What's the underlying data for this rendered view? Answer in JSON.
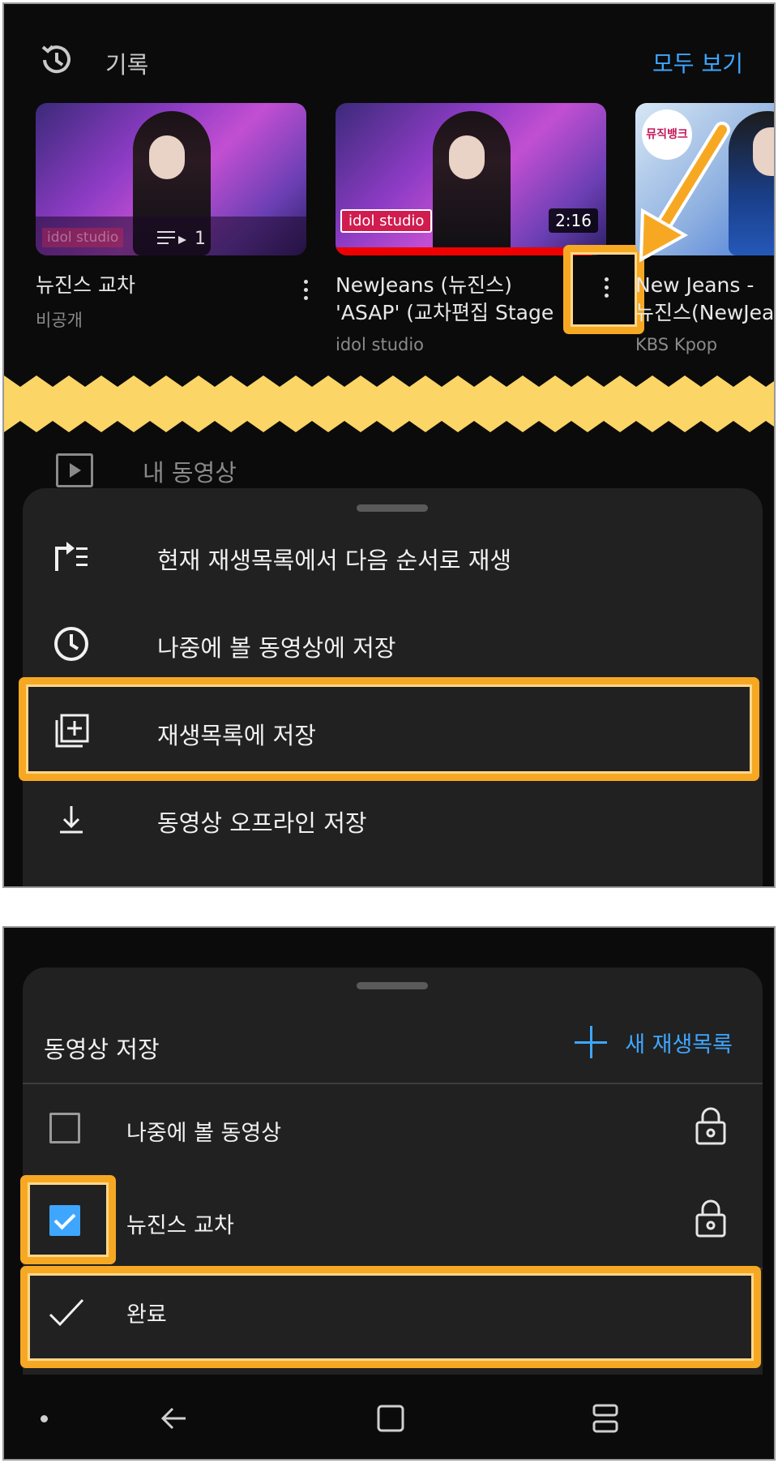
{
  "screen1": {
    "history": {
      "title": "기록",
      "see_all": "모두 보기"
    },
    "cards": [
      {
        "title": "뉴진스 교차",
        "subtitle": "비공개",
        "overlay_badge": "idol studio",
        "playlist_count": "1"
      },
      {
        "title_line1": "NewJeans (뉴진스)",
        "title_line2": "'ASAP' (교차편집 Stage",
        "channel": "idol studio",
        "badge": "idol studio",
        "duration": "2:16",
        "watched_fraction": 0.95
      },
      {
        "title_line1": "New Jeans -",
        "title_line2": "뉴진스(NewJea",
        "channel": "KBS Kpop",
        "logo_text": "뮤직뱅크"
      }
    ],
    "my_videos": "내 동영상",
    "menu": [
      {
        "icon": "play-next-icon",
        "label": "현재 재생목록에서 다음 순서로 재생"
      },
      {
        "icon": "clock-icon",
        "label": "나중에 볼 동영상에 저장"
      },
      {
        "icon": "playlist-add-icon",
        "label": "재생목록에 저장"
      },
      {
        "icon": "download-icon",
        "label": "동영상 오프라인 저장"
      }
    ]
  },
  "screen2": {
    "title": "동영상 저장",
    "new_playlist": "새 재생목록",
    "playlists": [
      {
        "label": "나중에 볼 동영상",
        "checked": false,
        "icon": "lock-icon"
      },
      {
        "label": "뉴진스 교차",
        "checked": true,
        "icon": "lock-icon"
      }
    ],
    "done": "완료"
  },
  "colors": {
    "highlight": "#f7a823",
    "accent": "#3ea6ff",
    "sheet": "#212121",
    "zigzag": "#fbd566"
  }
}
